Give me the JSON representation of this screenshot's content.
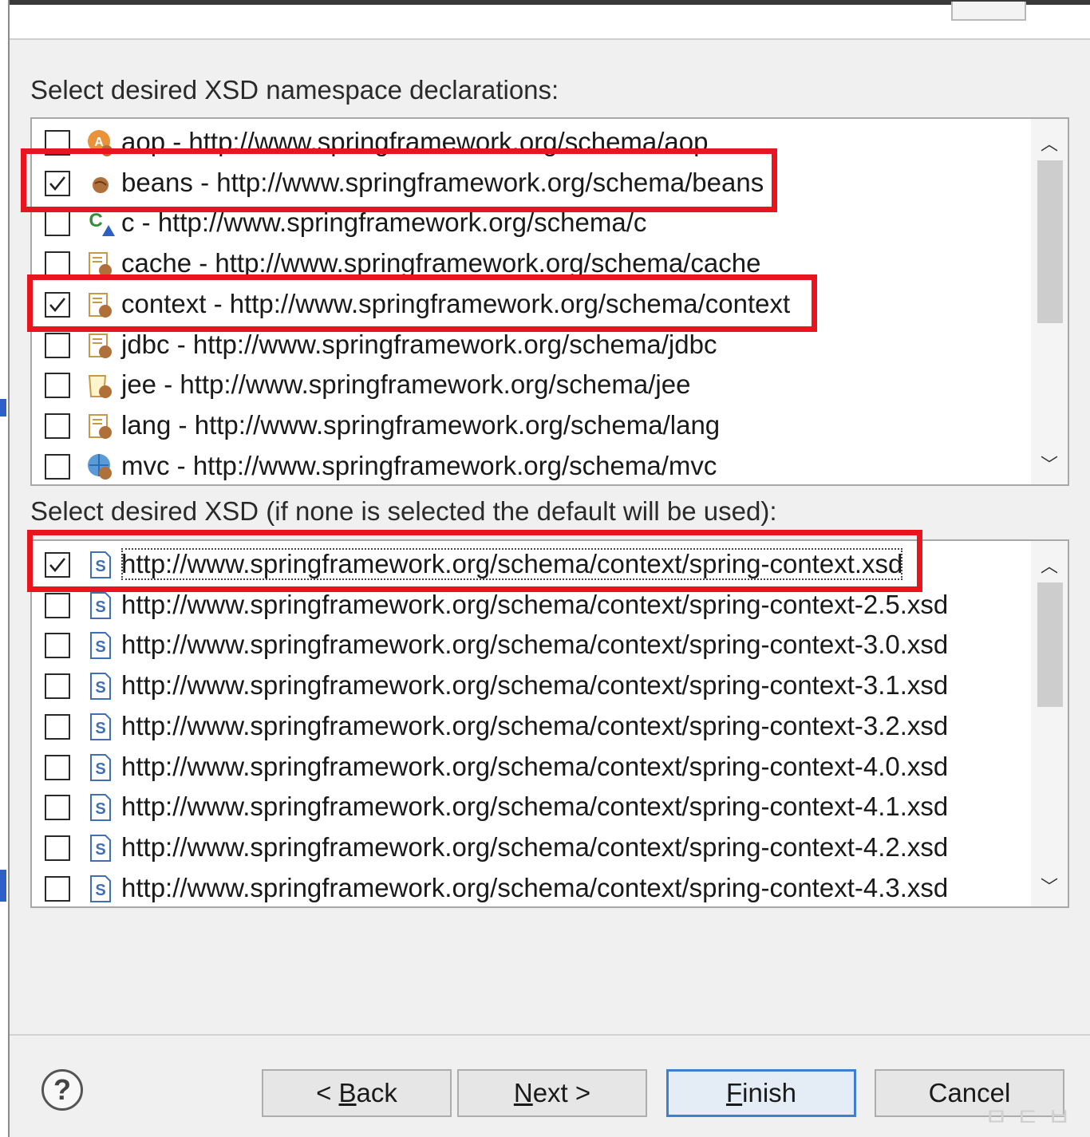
{
  "namespace_section": {
    "label": "Select desired XSD namespace declarations:",
    "items": [
      {
        "name": "aop - http://www.springframework.org/schema/aop",
        "checked": false,
        "icon": "aop-icon"
      },
      {
        "name": "beans - http://www.springframework.org/schema/beans",
        "checked": true,
        "icon": "beans-icon"
      },
      {
        "name": "c - http://www.springframework.org/schema/c",
        "checked": false,
        "icon": "c-icon"
      },
      {
        "name": "cache - http://www.springframework.org/schema/cache",
        "checked": false,
        "icon": "cache-icon"
      },
      {
        "name": "context - http://www.springframework.org/schema/context",
        "checked": true,
        "icon": "context-icon"
      },
      {
        "name": "jdbc - http://www.springframework.org/schema/jdbc",
        "checked": false,
        "icon": "jdbc-icon"
      },
      {
        "name": "jee - http://www.springframework.org/schema/jee",
        "checked": false,
        "icon": "jee-icon"
      },
      {
        "name": "lang - http://www.springframework.org/schema/lang",
        "checked": false,
        "icon": "lang-icon"
      },
      {
        "name": "mvc - http://www.springframework.org/schema/mvc",
        "checked": false,
        "icon": "mvc-icon"
      }
    ]
  },
  "xsd_section": {
    "label": "Select desired XSD (if none is selected the default will be used):",
    "items": [
      {
        "url": "http://www.springframework.org/schema/context/spring-context.xsd",
        "checked": true
      },
      {
        "url": "http://www.springframework.org/schema/context/spring-context-2.5.xsd",
        "checked": false
      },
      {
        "url": "http://www.springframework.org/schema/context/spring-context-3.0.xsd",
        "checked": false
      },
      {
        "url": "http://www.springframework.org/schema/context/spring-context-3.1.xsd",
        "checked": false
      },
      {
        "url": "http://www.springframework.org/schema/context/spring-context-3.2.xsd",
        "checked": false
      },
      {
        "url": "http://www.springframework.org/schema/context/spring-context-4.0.xsd",
        "checked": false
      },
      {
        "url": "http://www.springframework.org/schema/context/spring-context-4.1.xsd",
        "checked": false
      },
      {
        "url": "http://www.springframework.org/schema/context/spring-context-4.2.xsd",
        "checked": false
      },
      {
        "url": "http://www.springframework.org/schema/context/spring-context-4.3.xsd",
        "checked": false
      }
    ]
  },
  "buttons": {
    "help": "?",
    "back_prefix": "< ",
    "back_mnemonic": "B",
    "back_rest": "ack",
    "next_mnemonic": "N",
    "next_rest": "ext >",
    "finish_mnemonic": "F",
    "finish_rest": "inish",
    "cancel": "Cancel"
  },
  "colors": {
    "highlight_box": "#e8141e",
    "default_button_border": "#3c7fd3"
  },
  "watermark": "ㅁㄷㅂ"
}
